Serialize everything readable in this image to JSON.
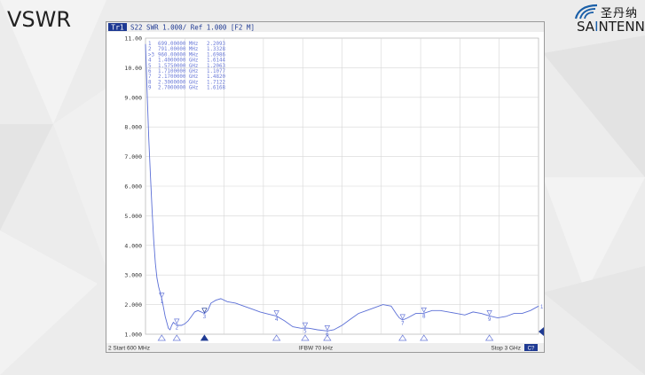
{
  "slide": {
    "title": "VSWR"
  },
  "logo": {
    "cn": "圣丹纳",
    "en_part1": "SA",
    "en_accent": "I",
    "en_part2": "NTENNA"
  },
  "colors": {
    "trace": "#5b6fd6",
    "marker_text": "#6a7ad8",
    "grid": "#cfcfcf",
    "active_marker": "#1f3a93",
    "header_badge": "#1f3a93"
  },
  "header": {
    "trace_badge": "Tr1",
    "label": "S22  SWR 1.000/ Ref 1.000 [F2 M]"
  },
  "footer": {
    "start": "2  Start 600 MHz",
    "ifbw": "IFBW 70 kHz",
    "stop": "Stop 3 GHz",
    "status_badge": "C?"
  },
  "marker_table": [
    {
      "id": "1",
      "freq": "699.00000 MHz",
      "value": "2.2093"
    },
    {
      "id": "2",
      "freq": "791.00000 MHz",
      "value": "1.3328"
    },
    {
      "id": ">3",
      "freq": "960.00000 MHz",
      "value": "1.6986"
    },
    {
      "id": "4",
      "freq": "1.4000000 GHz",
      "value": "1.6144"
    },
    {
      "id": "5",
      "freq": "1.5750000 GHz",
      "value": "1.2063"
    },
    {
      "id": "6",
      "freq": "1.7100000 GHz",
      "value": "1.1077"
    },
    {
      "id": "7",
      "freq": "2.1700000 GHz",
      "value": "1.4820"
    },
    {
      "id": "8",
      "freq": "2.3000000 GHz",
      "value": "1.7122"
    },
    {
      "id": "9",
      "freq": "2.7000000 GHz",
      "value": "1.6168"
    }
  ],
  "chart_data": {
    "type": "line",
    "title": "",
    "xlabel": "",
    "ylabel": "",
    "xlim": [
      600,
      3000
    ],
    "ylim": [
      1,
      11
    ],
    "yticks": [
      "1.000",
      "2.000",
      "3.000",
      "4.000",
      "5.000",
      "6.000",
      "7.000",
      "8.000",
      "9.000",
      "10.00",
      "11.00"
    ],
    "grid": true,
    "series": [
      {
        "x": [
          600,
          604,
          610,
          620,
          630,
          640,
          650,
          660,
          670,
          680,
          690,
          699,
          710,
          720,
          730,
          740,
          750,
          760,
          770,
          780,
          791,
          800,
          820,
          840,
          860,
          880,
          900,
          920,
          940,
          960,
          980,
          1000,
          1030,
          1060,
          1100,
          1150,
          1200,
          1250,
          1300,
          1350,
          1400,
          1450,
          1500,
          1550,
          1575,
          1600,
          1650,
          1710,
          1750,
          1800,
          1850,
          1900,
          1950,
          2000,
          2050,
          2100,
          2130,
          2150,
          2170,
          2200,
          2250,
          2300,
          2350,
          2400,
          2450,
          2500,
          2550,
          2600,
          2650,
          2700,
          2750,
          2800,
          2850,
          2900,
          2950,
          3000
        ],
        "y": [
          10.8,
          10.2,
          9.2,
          7.6,
          6.4,
          5.2,
          4.2,
          3.4,
          2.9,
          2.6,
          2.4,
          2.21,
          1.9,
          1.6,
          1.4,
          1.2,
          1.15,
          1.3,
          1.4,
          1.35,
          1.33,
          1.3,
          1.3,
          1.35,
          1.45,
          1.6,
          1.75,
          1.8,
          1.75,
          1.7,
          1.8,
          2.05,
          2.15,
          2.2,
          2.1,
          2.05,
          1.95,
          1.85,
          1.75,
          1.68,
          1.61,
          1.45,
          1.25,
          1.2,
          1.21,
          1.2,
          1.15,
          1.11,
          1.15,
          1.3,
          1.5,
          1.7,
          1.8,
          1.9,
          2.0,
          1.95,
          1.7,
          1.55,
          1.48,
          1.55,
          1.7,
          1.71,
          1.8,
          1.8,
          1.75,
          1.7,
          1.65,
          1.75,
          1.7,
          1.62,
          1.55,
          1.6,
          1.7,
          1.7,
          1.8,
          1.95
        ]
      }
    ],
    "markers": [
      {
        "label": "1",
        "x": 699,
        "y": 2.2093
      },
      {
        "label": "2",
        "x": 791,
        "y": 1.3328
      },
      {
        "label": "3",
        "x": 960,
        "y": 1.6986
      },
      {
        "label": "4",
        "x": 1400,
        "y": 1.6144
      },
      {
        "label": "5",
        "x": 1575,
        "y": 1.2063
      },
      {
        "label": "6",
        "x": 1710,
        "y": 1.1077
      },
      {
        "label": "7",
        "x": 2170,
        "y": 1.482
      },
      {
        "label": "8",
        "x": 2300,
        "y": 1.7122
      },
      {
        "label": "9",
        "x": 2700,
        "y": 1.6168
      }
    ],
    "end_marker_label": "1"
  }
}
